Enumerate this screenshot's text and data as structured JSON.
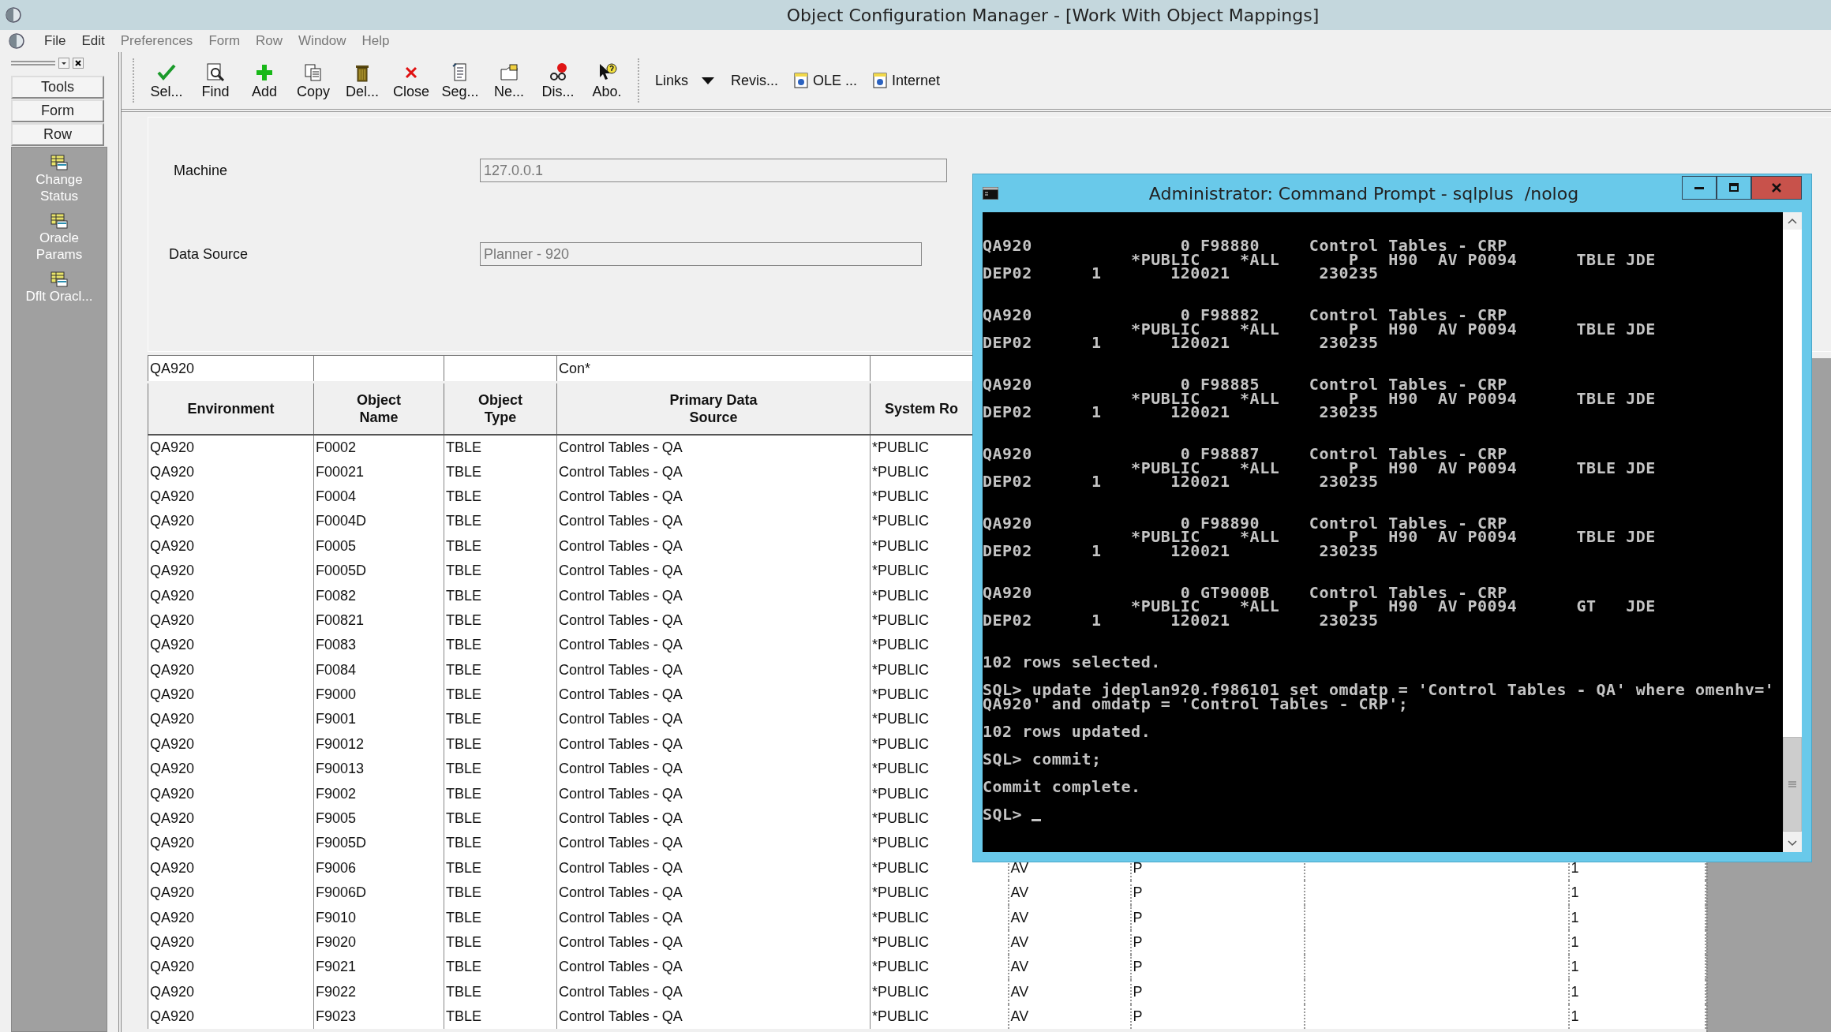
{
  "window": {
    "title": "Object Configuration Manager - [Work With Object Mappings]"
  },
  "menu": [
    {
      "label": "File",
      "disabled": false
    },
    {
      "label": "Edit",
      "disabled": false
    },
    {
      "label": "Preferences",
      "disabled": true
    },
    {
      "label": "Form",
      "disabled": true
    },
    {
      "label": "Row",
      "disabled": true
    },
    {
      "label": "Window",
      "disabled": true
    },
    {
      "label": "Help",
      "disabled": true
    }
  ],
  "toolbar": {
    "buttons": [
      {
        "label": "Sel..."
      },
      {
        "label": "Find"
      },
      {
        "label": "Add"
      },
      {
        "label": "Copy"
      },
      {
        "label": "Del..."
      },
      {
        "label": "Close"
      },
      {
        "label": "Seg..."
      },
      {
        "label": "Ne..."
      },
      {
        "label": "Dis..."
      },
      {
        "label": "Abo."
      }
    ],
    "links": [
      {
        "label": "Links",
        "kind": "dropdown"
      },
      {
        "label": "Revis...",
        "kind": "plain"
      },
      {
        "label": "OLE ...",
        "kind": "document"
      },
      {
        "label": "Internet",
        "kind": "document"
      }
    ]
  },
  "sidebar": {
    "tabs": [
      {
        "label": "Tools"
      },
      {
        "label": "Form"
      },
      {
        "label": "Row"
      }
    ],
    "items": [
      {
        "label": "Change Status"
      },
      {
        "label": "Oracle Params"
      },
      {
        "label": "Dflt Oracl..."
      }
    ]
  },
  "form": {
    "fields": [
      {
        "label": "Machine",
        "value": "127.0.0.1"
      },
      {
        "label": "Data Source",
        "value": "Planner - 920"
      }
    ]
  },
  "grid": {
    "columns": [
      {
        "heading": "Environment",
        "filter": "QA920"
      },
      {
        "heading": "Object Name"
      },
      {
        "heading": "Object Type"
      },
      {
        "heading": "Primary Data Source",
        "filter": "Con*"
      },
      {
        "heading": "System Ro"
      }
    ],
    "rows": [
      {
        "cells": [
          "QA920",
          "F0002",
          "TBLE",
          "Control Tables - QA",
          "*PUBLIC"
        ]
      },
      {
        "cells": [
          "QA920",
          "F00021",
          "TBLE",
          "Control Tables - QA",
          "*PUBLIC"
        ]
      },
      {
        "cells": [
          "QA920",
          "F0004",
          "TBLE",
          "Control Tables - QA",
          "*PUBLIC"
        ]
      },
      {
        "cells": [
          "QA920",
          "F0004D",
          "TBLE",
          "Control Tables - QA",
          "*PUBLIC"
        ]
      },
      {
        "cells": [
          "QA920",
          "F0005",
          "TBLE",
          "Control Tables - QA",
          "*PUBLIC"
        ]
      },
      {
        "cells": [
          "QA920",
          "F0005D",
          "TBLE",
          "Control Tables - QA",
          "*PUBLIC"
        ]
      },
      {
        "cells": [
          "QA920",
          "F0082",
          "TBLE",
          "Control Tables - QA",
          "*PUBLIC"
        ]
      },
      {
        "cells": [
          "QA920",
          "F00821",
          "TBLE",
          "Control Tables - QA",
          "*PUBLIC"
        ]
      },
      {
        "cells": [
          "QA920",
          "F0083",
          "TBLE",
          "Control Tables - QA",
          "*PUBLIC"
        ]
      },
      {
        "cells": [
          "QA920",
          "F0084",
          "TBLE",
          "Control Tables - QA",
          "*PUBLIC"
        ]
      },
      {
        "cells": [
          "QA920",
          "F9000",
          "TBLE",
          "Control Tables - QA",
          "*PUBLIC"
        ]
      },
      {
        "cells": [
          "QA920",
          "F9001",
          "TBLE",
          "Control Tables - QA",
          "*PUBLIC"
        ]
      },
      {
        "cells": [
          "QA920",
          "F90012",
          "TBLE",
          "Control Tables - QA",
          "*PUBLIC"
        ]
      },
      {
        "cells": [
          "QA920",
          "F90013",
          "TBLE",
          "Control Tables - QA",
          "*PUBLIC"
        ]
      },
      {
        "cells": [
          "QA920",
          "F9002",
          "TBLE",
          "Control Tables - QA",
          "*PUBLIC"
        ]
      },
      {
        "cells": [
          "QA920",
          "F9005",
          "TBLE",
          "Control Tables - QA",
          "*PUBLIC"
        ]
      },
      {
        "cells": [
          "QA920",
          "F9005D",
          "TBLE",
          "Control Tables - QA",
          "*PUBLIC"
        ]
      },
      {
        "cells": [
          "QA920",
          "F9006",
          "TBLE",
          "Control Tables - QA",
          "*PUBLIC"
        ],
        "column_6": "AV",
        "column_7": "P",
        "column_9": "1"
      },
      {
        "cells": [
          "QA920",
          "F9006D",
          "TBLE",
          "Control Tables - QA",
          "*PUBLIC"
        ],
        "column_6": "AV",
        "column_7": "P",
        "column_9": "1"
      },
      {
        "cells": [
          "QA920",
          "F9010",
          "TBLE",
          "Control Tables - QA",
          "*PUBLIC"
        ],
        "column_6": "AV",
        "column_7": "P",
        "column_9": "1"
      },
      {
        "cells": [
          "QA920",
          "F9020",
          "TBLE",
          "Control Tables - QA",
          "*PUBLIC"
        ],
        "column_6": "AV",
        "column_7": "P",
        "column_9": "1"
      },
      {
        "cells": [
          "QA920",
          "F9021",
          "TBLE",
          "Control Tables - QA",
          "*PUBLIC"
        ],
        "column_6": "AV",
        "column_7": "P",
        "column_9": "1"
      },
      {
        "cells": [
          "QA920",
          "F9022",
          "TBLE",
          "Control Tables - QA",
          "*PUBLIC"
        ],
        "column_6": "AV",
        "column_7": "P",
        "column_9": "1"
      },
      {
        "cells": [
          "QA920",
          "F9023",
          "TBLE",
          "Control Tables - QA",
          "*PUBLIC"
        ],
        "column_6": "AV",
        "column_7": "P",
        "column_9": "1"
      }
    ]
  },
  "console": {
    "title": "Administrator: Command Prompt - sqlplus  /nolog",
    "blocks": [
      {
        "kind": "record",
        "lines": [
          "QA920               0 F98880     Control Tables - CRP",
          "               *PUBLIC    *ALL       P   H90  AV P0094      TBLE JDE",
          "DEP02      1       120021         230235"
        ]
      },
      {
        "kind": "record",
        "lines": [
          "QA920               0 F98882     Control Tables - CRP",
          "               *PUBLIC    *ALL       P   H90  AV P0094      TBLE JDE",
          "DEP02      1       120021         230235"
        ]
      },
      {
        "kind": "record",
        "lines": [
          "QA920               0 F98885     Control Tables - CRP",
          "               *PUBLIC    *ALL       P   H90  AV P0094      TBLE JDE",
          "DEP02      1       120021         230235"
        ]
      },
      {
        "kind": "record",
        "lines": [
          "QA920               0 F98887     Control Tables - CRP",
          "               *PUBLIC    *ALL       P   H90  AV P0094      TBLE JDE",
          "DEP02      1       120021         230235"
        ]
      },
      {
        "kind": "record",
        "lines": [
          "QA920               0 F98890     Control Tables - CRP",
          "               *PUBLIC    *ALL       P   H90  AV P0094      TBLE JDE",
          "DEP02      1       120021         230235"
        ]
      },
      {
        "kind": "record",
        "lines": [
          "QA920               0 GT9000B    Control Tables - CRP",
          "               *PUBLIC    *ALL       P   H90  AV P0094      GT   JDE",
          "DEP02      1       120021         230235"
        ]
      },
      {
        "kind": "message",
        "lines": [
          "102 rows selected."
        ]
      },
      {
        "kind": "message",
        "lines": [
          "SQL> update jdeplan920.f986101 set omdatp = 'Control Tables - QA' where omenhv='",
          "QA920' and omdatp = 'Control Tables - CRP';"
        ]
      },
      {
        "kind": "message",
        "lines": [
          "102 rows updated."
        ]
      },
      {
        "kind": "message",
        "lines": [
          "SQL> commit;"
        ]
      },
      {
        "kind": "message",
        "lines": [
          "Commit complete."
        ]
      },
      {
        "kind": "prompt",
        "lines": [
          "SQL>"
        ]
      }
    ]
  }
}
